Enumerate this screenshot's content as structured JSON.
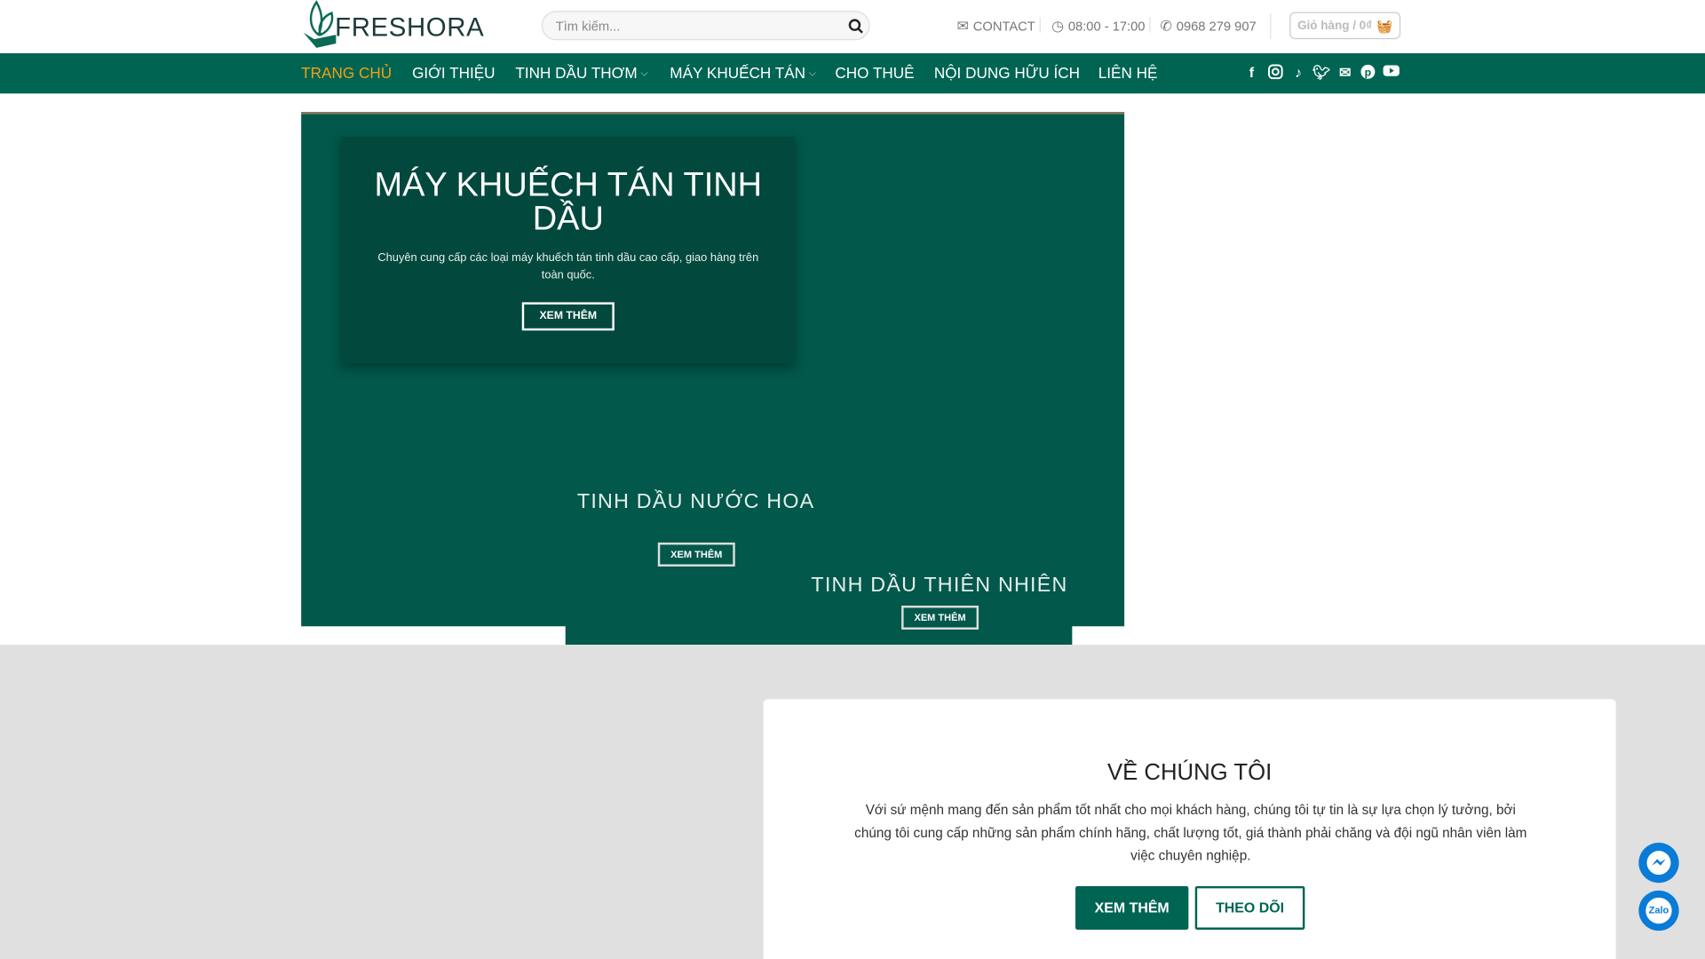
{
  "brand": {
    "name": "FRESHORA",
    "primary": "#006452",
    "accent": "#f0a018"
  },
  "header": {
    "search_placeholder": "Tìm kiếm...",
    "contact": "CONTACT",
    "hours": "08:00 - 17:00",
    "phone": "0968 279 907",
    "cart": "Giỏ hàng / 0₫"
  },
  "nav": {
    "items": [
      {
        "label": "TRANG CHỦ",
        "active": true
      },
      {
        "label": "GIỚI THIỆU"
      },
      {
        "label": "TINH DẦU THƠM",
        "dropdown": true
      },
      {
        "label": "MÁY KHUẾCH TÁN",
        "dropdown": true
      },
      {
        "label": "CHO THUÊ"
      },
      {
        "label": "NỘI DUNG HỮU ÍCH"
      },
      {
        "label": "LIÊN HỆ"
      }
    ],
    "social": [
      "facebook-icon",
      "instagram-icon",
      "tiktok-icon",
      "twitter-icon",
      "email-icon",
      "pinterest-icon",
      "youtube-icon"
    ]
  },
  "banner": {
    "main": {
      "title": "MÁY KHUẾCH TÁN TINH DẦU",
      "text": "Chuyên cung cấp các loại máy khuếch tán tinh dầu cao cấp, giao hàng trên toàn quốc.",
      "button": "XEM THÊM"
    },
    "perfume": {
      "title": "TINH DẦU NƯỚC HOA",
      "button": "XEM THÊM"
    },
    "natural": {
      "title": "TINH DẦU THIÊN NHIÊN",
      "button": "XEM THÊM"
    }
  },
  "about": {
    "title": "VỀ CHÚNG TÔI",
    "text": "Với sứ mệnh mang đến sản phẩm tốt nhất cho mọi khách hàng, chúng tôi tự tin là sự lựa chọn lý tưởng, bởi chúng tôi cung cấp những sản phẩm chính hãng, chất lượng tốt, giá thành phải chăng và đội ngũ nhân viên làm việc chuyên nghiệp.",
    "btn_more": "XEM THÊM",
    "btn_follow": "THEO DÕI"
  },
  "floating": {
    "zalo": "Zalo"
  }
}
